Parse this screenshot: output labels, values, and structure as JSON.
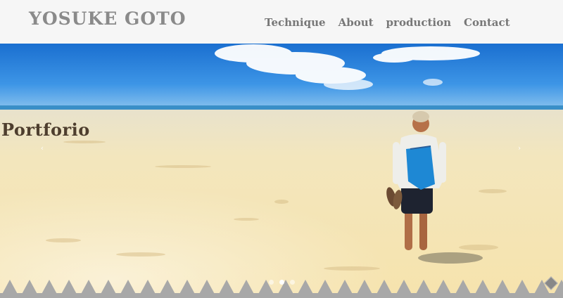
{
  "header": {
    "logo": "YOSUKE GOTO",
    "nav": [
      "Technique",
      "About",
      "production",
      "Contact"
    ]
  },
  "slider": {
    "caption": "Portforio",
    "prev_icon": "chevron-left-icon",
    "next_icon": "chevron-right-icon",
    "slide_count": 3,
    "active_slide": 2
  },
  "colors": {
    "header_bg": "#f6f6f6",
    "text": "#777777",
    "sky": "#1f7bd8",
    "sand": "#f1e3b4",
    "sawtooth": "#a8a8a8"
  }
}
